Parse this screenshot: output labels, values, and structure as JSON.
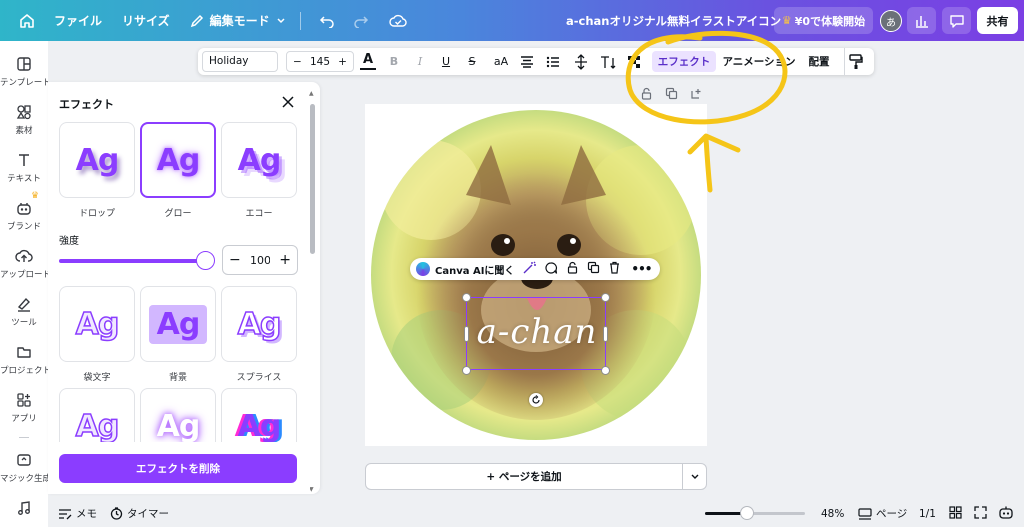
{
  "topbar": {
    "file": "ファイル",
    "resize": "リサイズ",
    "edit_mode": "編集モード",
    "title": "a-chanオリジナル無料イラストアイコン",
    "trial": "¥0で体験開始",
    "avatar": "あ",
    "share": "共有"
  },
  "rail": [
    {
      "label": "テンプレート",
      "icon": "template-icon"
    },
    {
      "label": "素材",
      "icon": "elements-icon"
    },
    {
      "label": "テキスト",
      "icon": "text-icon"
    },
    {
      "label": "ブランド",
      "icon": "brand-icon"
    },
    {
      "label": "アップロード",
      "icon": "upload-icon"
    },
    {
      "label": "ツール",
      "icon": "draw-icon"
    },
    {
      "label": "プロジェクト",
      "icon": "folder-icon"
    },
    {
      "label": "アプリ",
      "icon": "apps-icon"
    },
    {
      "label": "マジック生成",
      "icon": "magic-icon"
    }
  ],
  "panel": {
    "title": "エフェクト",
    "tile_text": "Ag",
    "tiles": [
      {
        "label": "ドロップ",
        "style": "drop"
      },
      {
        "label": "グロー",
        "style": "glow",
        "selected": true
      },
      {
        "label": "エコー",
        "style": "echo"
      },
      {
        "label": "袋文字",
        "style": "hollow"
      },
      {
        "label": "背景",
        "style": "bg"
      },
      {
        "label": "スプライス",
        "style": "splice"
      },
      {
        "label": "",
        "style": "hollow"
      },
      {
        "label": "",
        "style": "neon"
      },
      {
        "label": "",
        "style": "glitch"
      }
    ],
    "strength_label": "強度",
    "strength_value": "100",
    "strength_level": 1.0,
    "remove_button": "エフェクトを削除"
  },
  "toolbar": {
    "font": "Holiday",
    "size": "145",
    "case": "aA",
    "effects": "エフェクト",
    "animate": "アニメーション",
    "position": "配置"
  },
  "context_bar": {
    "ask_ai": "Canva AIに聞く"
  },
  "canvas": {
    "text": "a-chan",
    "add_page": "+ ページを追加"
  },
  "bottombar": {
    "notes": "メモ",
    "timer": "タイマー",
    "zoom": "48%",
    "pages_label": "ページ",
    "page_count": "1/1",
    "zoom_level": 0.48
  },
  "colors": {
    "accent": "#8b3dff",
    "annotation": "#f5c518"
  }
}
